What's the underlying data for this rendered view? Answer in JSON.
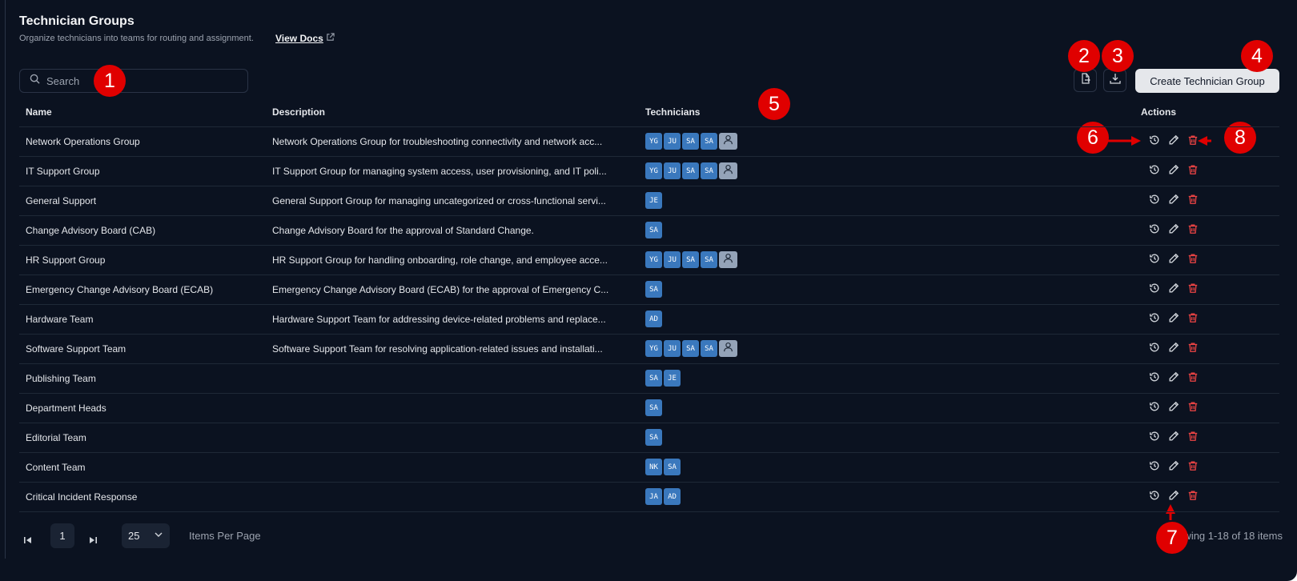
{
  "header": {
    "title": "Technician Groups",
    "subtitle": "Organize technicians into teams for routing and assignment.",
    "docs_label": "View Docs"
  },
  "search": {
    "placeholder": "Search"
  },
  "toolbar": {
    "create_label": "Create Technician Group"
  },
  "table": {
    "columns": {
      "name": "Name",
      "description": "Description",
      "technicians": "Technicians",
      "actions": "Actions"
    },
    "rows": [
      {
        "name": "Network Operations Group",
        "description": "Network Operations Group for troubleshooting connectivity and network acc...",
        "techs": [
          "YG",
          "JU",
          "SA",
          "SA"
        ],
        "more": true
      },
      {
        "name": "IT Support Group",
        "description": "IT Support Group for managing system access, user provisioning, and IT poli...",
        "techs": [
          "YG",
          "JU",
          "SA",
          "SA"
        ],
        "more": true
      },
      {
        "name": "General Support",
        "description": "General Support Group for managing uncategorized or cross-functional servi...",
        "techs": [
          "JE"
        ],
        "more": false
      },
      {
        "name": "Change Advisory Board (CAB)",
        "description": "Change Advisory Board for the approval of Standard Change.",
        "techs": [
          "SA"
        ],
        "more": false
      },
      {
        "name": "HR Support Group",
        "description": "HR Support Group for handling onboarding, role change, and employee acce...",
        "techs": [
          "YG",
          "JU",
          "SA",
          "SA"
        ],
        "more": true
      },
      {
        "name": "Emergency Change Advisory Board (ECAB)",
        "description": "Emergency Change Advisory Board (ECAB) for the approval of Emergency C...",
        "techs": [
          "SA"
        ],
        "more": false
      },
      {
        "name": "Hardware Team",
        "description": "Hardware Support Team for addressing device-related problems and replace...",
        "techs": [
          "AD"
        ],
        "more": false
      },
      {
        "name": "Software Support Team",
        "description": "Software Support Team for resolving application-related issues and installati...",
        "techs": [
          "YG",
          "JU",
          "SA",
          "SA"
        ],
        "more": true
      },
      {
        "name": "Publishing Team",
        "description": "",
        "techs": [
          "SA",
          "JE"
        ],
        "more": false
      },
      {
        "name": "Department Heads",
        "description": "",
        "techs": [
          "SA"
        ],
        "more": false
      },
      {
        "name": "Editorial Team",
        "description": "",
        "techs": [
          "SA"
        ],
        "more": false
      },
      {
        "name": "Content Team",
        "description": "",
        "techs": [
          "NK",
          "SA"
        ],
        "more": false
      },
      {
        "name": "Critical Incident Response",
        "description": "",
        "techs": [
          "JA",
          "AD"
        ],
        "more": false
      }
    ]
  },
  "pagination": {
    "page": "1",
    "per_page": "25",
    "per_page_label": "Items Per Page",
    "showing": "Showing 1-18 of 18 items"
  },
  "annotations": [
    "1",
    "2",
    "3",
    "4",
    "5",
    "6",
    "7",
    "8"
  ],
  "colors": {
    "background": "#0b1220",
    "chip": "#3a78bd",
    "delete": "#ef4444",
    "marker": "#e00000"
  },
  "icons": [
    "search-icon",
    "external-link-icon",
    "export-icon",
    "download-icon",
    "history-icon",
    "edit-icon",
    "trash-icon",
    "user-icon",
    "first-page-icon",
    "last-page-icon",
    "chevron-down-icon"
  ]
}
